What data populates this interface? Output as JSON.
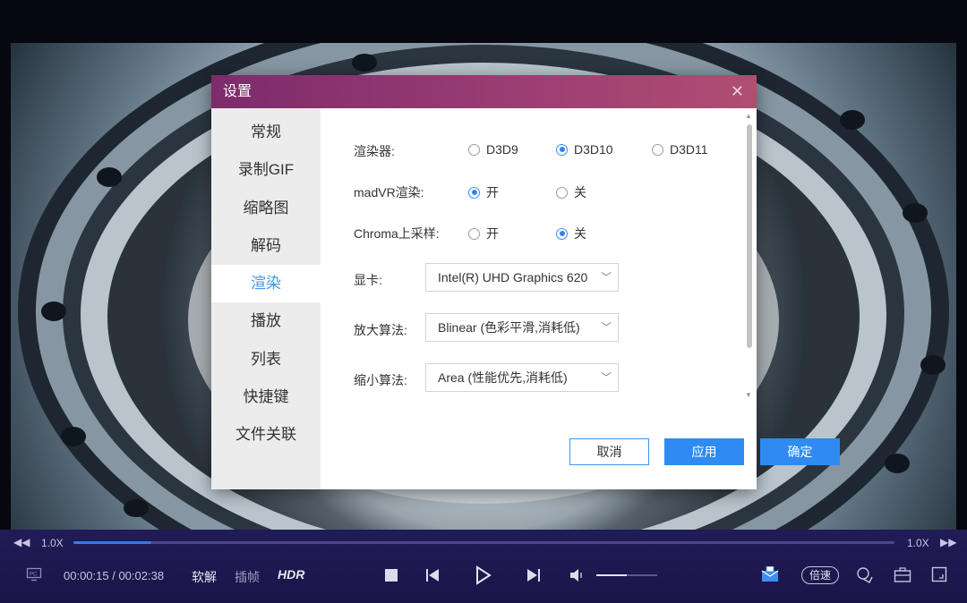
{
  "dialog": {
    "title": "设置",
    "close_icon": "close-icon"
  },
  "nav": {
    "items": [
      {
        "label": "常规"
      },
      {
        "label": "录制GIF"
      },
      {
        "label": "缩略图"
      },
      {
        "label": "解码"
      },
      {
        "label": "渲染"
      },
      {
        "label": "播放"
      },
      {
        "label": "列表"
      },
      {
        "label": "快捷键"
      },
      {
        "label": "文件关联"
      }
    ],
    "active": "渲染"
  },
  "render": {
    "renderer": {
      "label": "渲染器:",
      "options": [
        "D3D9",
        "D3D10",
        "D3D11"
      ],
      "selected": "D3D10"
    },
    "madvr": {
      "label": "madVR渲染:",
      "options": [
        "开",
        "关"
      ],
      "selected": "开"
    },
    "chroma": {
      "label": "Chroma上采样:",
      "options": [
        "开",
        "关"
      ],
      "selected": "关"
    },
    "gpu": {
      "label": "显卡:",
      "value": "Intel(R) UHD Graphics 620"
    },
    "upscale": {
      "label": "放大算法:",
      "value": "Blinear (色彩平滑,消耗低)"
    },
    "downscale": {
      "label": "缩小算法:",
      "value": "Area (性能优先,消耗低)"
    }
  },
  "buttons": {
    "cancel": "取消",
    "apply": "应用",
    "ok": "确定"
  },
  "player": {
    "speed_left": "1.0X",
    "speed_right": "1.0X",
    "progress": 0.095,
    "time": "00:00:15 / 00:02:38",
    "soft_decode": "软解",
    "frame_interp": "插帧",
    "hdr": "HDR",
    "speed_button": "倍速",
    "volume": 0.5,
    "accent": "#3c78e6"
  }
}
